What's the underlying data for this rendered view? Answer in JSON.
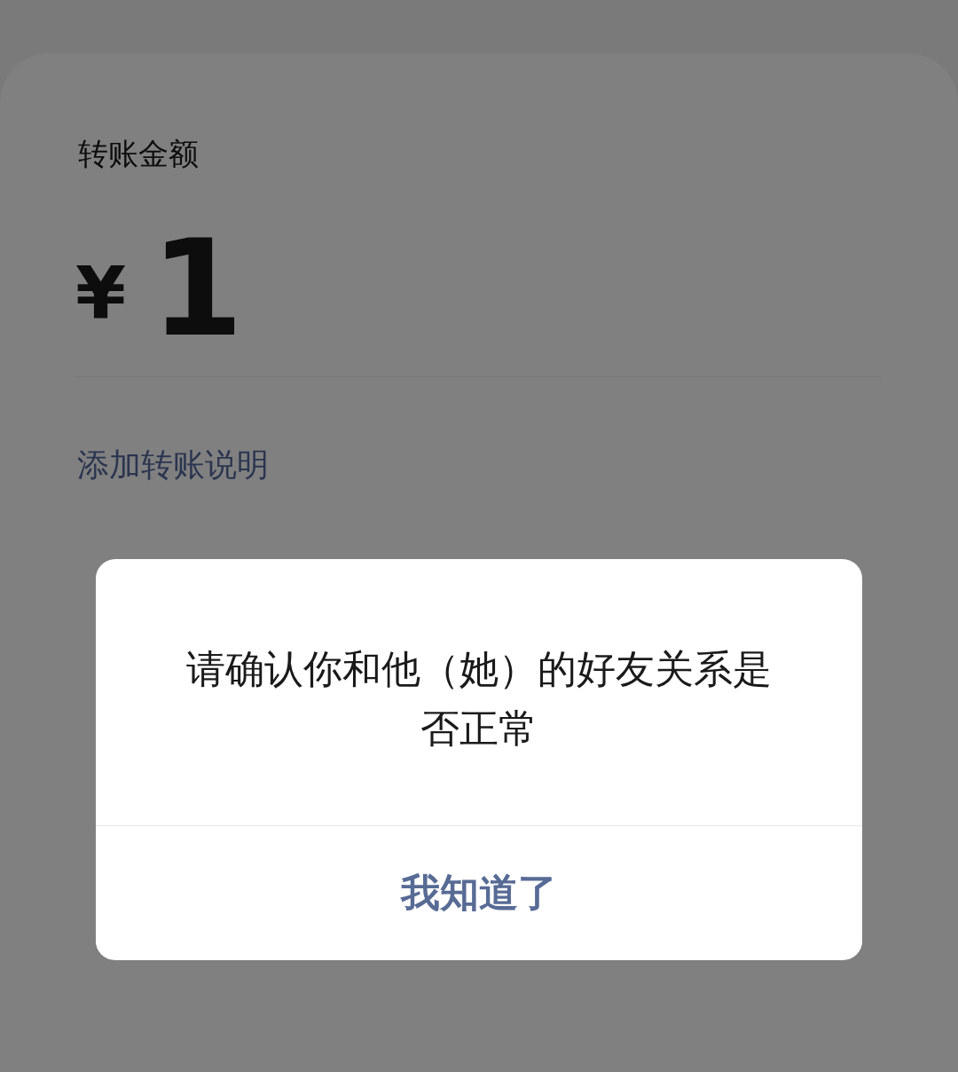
{
  "transfer": {
    "amount_label": "转账金额",
    "currency": "¥",
    "amount": "1",
    "add_note_link": "添加转账说明"
  },
  "dialog": {
    "message": "请确认你和他（她）的好友关系是否正常",
    "buttons": [
      {
        "label": "我知道了"
      }
    ]
  }
}
